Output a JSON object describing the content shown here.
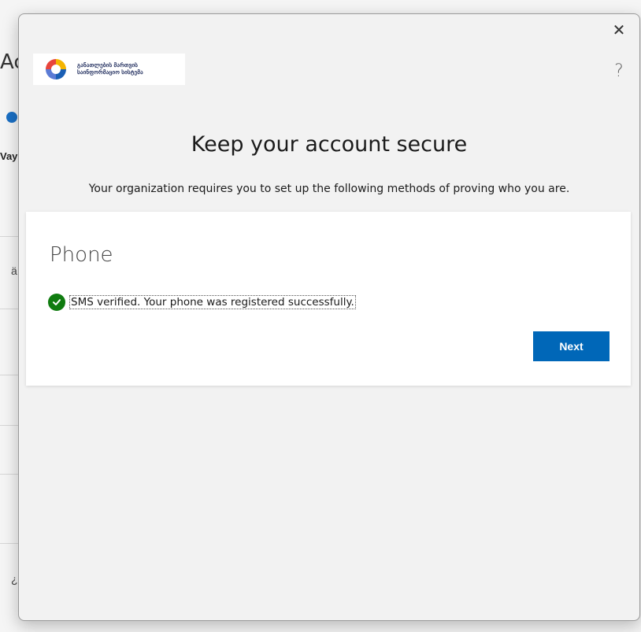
{
  "background": {
    "title_fragment": "Ac",
    "side_label": "Vay"
  },
  "dialog": {
    "close_glyph": "✕",
    "help_glyph": "?",
    "logo": {
      "line1": "განათლების მართვის",
      "line2": "საინფორმაციო სისტემა",
      "colors": [
        "#e8453c",
        "#f4b400",
        "#1a5fb4",
        "#5b7bd5"
      ]
    },
    "title": "Keep your account secure",
    "subtitle": "Your organization requires you to set up the following methods of proving who you are.",
    "card": {
      "heading": "Phone",
      "status_icon": "check-circle-icon",
      "status_text": "SMS verified. Your phone was registered successfully.",
      "next_label": "Next"
    }
  },
  "colors": {
    "accent": "#0067b8",
    "success": "#107c10",
    "dialog_bg": "#f2f2f2"
  }
}
